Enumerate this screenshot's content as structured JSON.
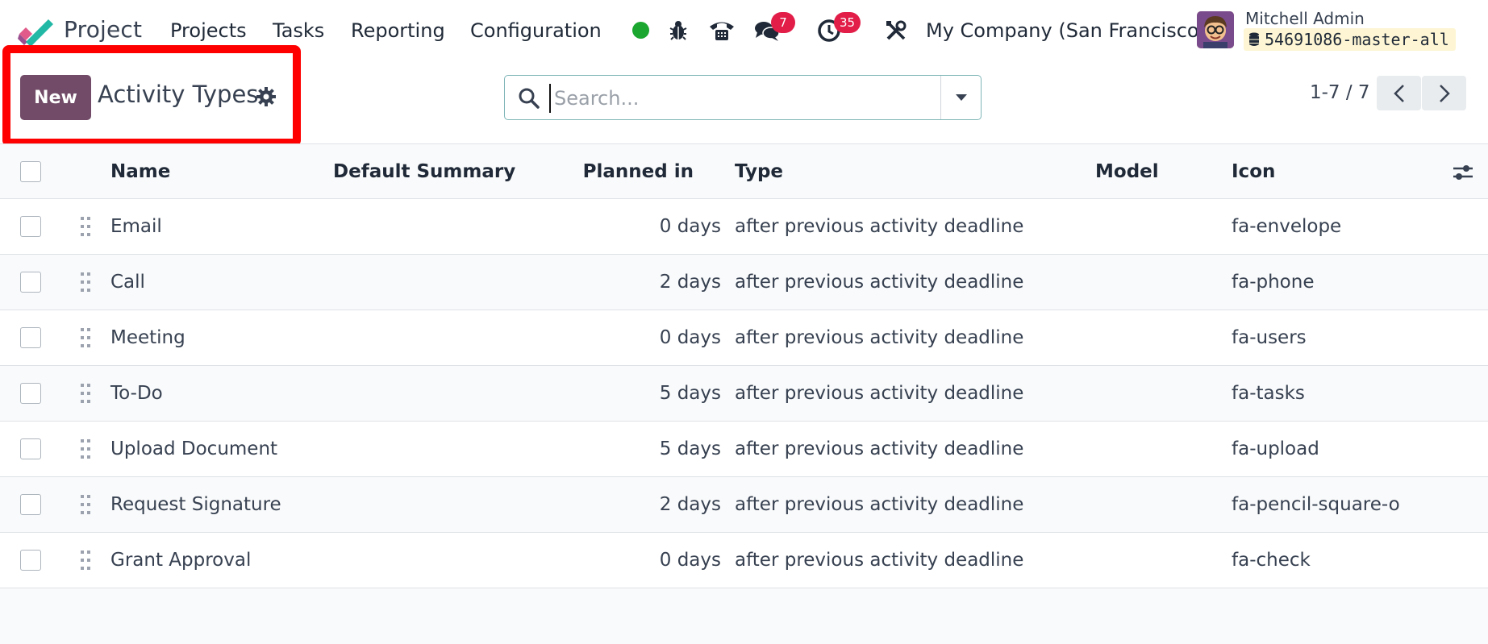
{
  "navbar": {
    "app_name": "Project",
    "menu": [
      "Projects",
      "Tasks",
      "Reporting",
      "Configuration"
    ],
    "messages_count": "7",
    "activities_count": "35",
    "company": "My Company (San Francisco)",
    "user_name": "Mitchell Admin",
    "database": "54691086-master-all",
    "colors": {
      "online": "#1ba62f",
      "badge": "#e11d48"
    }
  },
  "control_panel": {
    "new_label": "New",
    "title": "Activity Types",
    "search_placeholder": "Search...",
    "pager": "1-7 / 7",
    "colors": {
      "primary": "#714b67",
      "highlight": "#ff0000"
    }
  },
  "list": {
    "columns": [
      "Name",
      "Default Summary",
      "Planned in",
      "Type",
      "Model",
      "Icon"
    ],
    "rows": [
      {
        "name": "Email",
        "summary": "",
        "planned": "0 days",
        "type": "after previous activity deadline",
        "model": "",
        "icon": "fa-envelope"
      },
      {
        "name": "Call",
        "summary": "",
        "planned": "2 days",
        "type": "after previous activity deadline",
        "model": "",
        "icon": "fa-phone"
      },
      {
        "name": "Meeting",
        "summary": "",
        "planned": "0 days",
        "type": "after previous activity deadline",
        "model": "",
        "icon": "fa-users"
      },
      {
        "name": "To-Do",
        "summary": "",
        "planned": "5 days",
        "type": "after previous activity deadline",
        "model": "",
        "icon": "fa-tasks"
      },
      {
        "name": "Upload Document",
        "summary": "",
        "planned": "5 days",
        "type": "after previous activity deadline",
        "model": "",
        "icon": "fa-upload"
      },
      {
        "name": "Request Signature",
        "summary": "",
        "planned": "2 days",
        "type": "after previous activity deadline",
        "model": "",
        "icon": "fa-pencil-square-o"
      },
      {
        "name": "Grant Approval",
        "summary": "",
        "planned": "0 days",
        "type": "after previous activity deadline",
        "model": "",
        "icon": "fa-check"
      }
    ]
  }
}
